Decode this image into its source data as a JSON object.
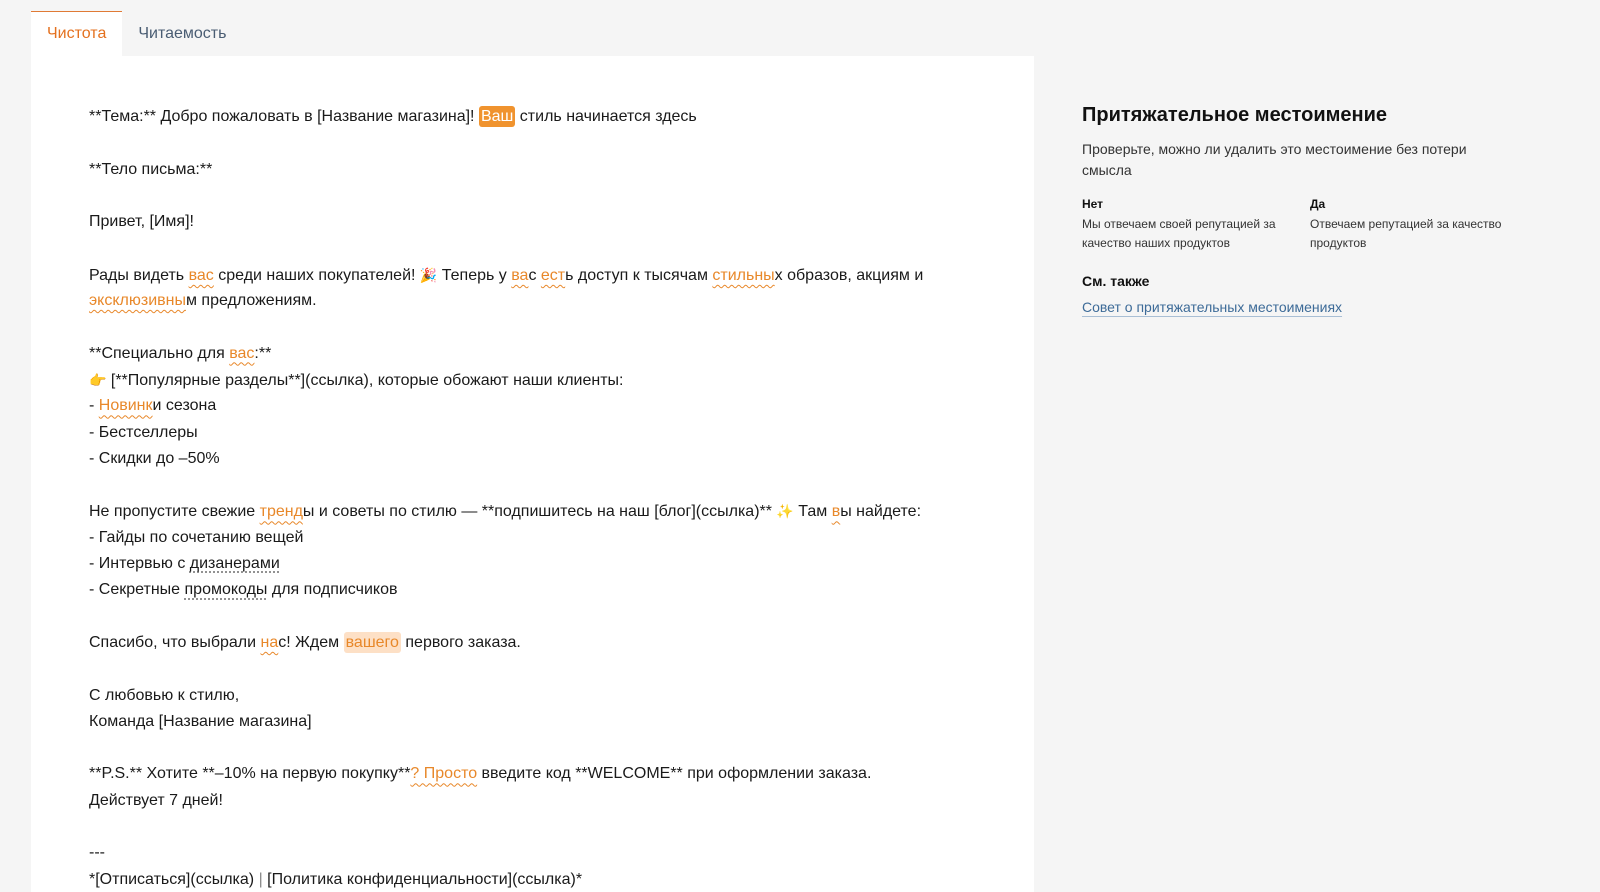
{
  "tabs": [
    {
      "label": "Чистота",
      "active": true
    },
    {
      "label": "Читаемость",
      "active": false
    }
  ],
  "colors": {
    "accent": "#e8882a",
    "selection": "#f0932e",
    "link": "#3d6b98"
  },
  "doc": {
    "l1": {
      "a": "**Тема:** Добро пожаловать в [Название магазина]! ",
      "sel": "Ваш",
      "b": " стиль начинается здесь"
    },
    "l2": "**Тело письма:**",
    "l3": "Привет, [Имя]!",
    "l4": {
      "a": "Рады видеть ",
      "f1": "вас",
      "b": " среди наших покупателей! ",
      "emoji": "🎉",
      "c": " Теперь у ",
      "f2": "ва",
      "d": "с ",
      "f3": "ест",
      "e": "ь доступ к тысячам ",
      "f4": "стильны",
      "f": "х образов, акциям и"
    },
    "l5": {
      "f1": "эксклюзивны",
      "a": "м предложениям."
    },
    "l6": {
      "a": "**Специально для ",
      "f1": "вас",
      "b": ":**"
    },
    "l7": {
      "emoji": "👉",
      "a": " [**Популярные разделы**](ссылка), которые обожают наши клиенты:"
    },
    "l8": {
      "a": "- ",
      "f1": "Новинк",
      "b": "и сезона"
    },
    "l9": "- Бестселлеры",
    "l10": "- Скидки до –50%",
    "l11": {
      "a": "Не пропустите свежие ",
      "f1": "тренд",
      "b": "ы и советы по стилю — **подпишитесь на наш [блог](ссылка)** ",
      "emoji": "✨",
      "c": " Там ",
      "f2": "в",
      "d": "ы найдете:"
    },
    "l12": "- Гайды по сочетанию вещей",
    "l13": {
      "a": "- Интервью с ",
      "d1": "дизанерами"
    },
    "l14": {
      "a": "- Секретные ",
      "d1": "промокоды",
      "b": " для подписчиков"
    },
    "l15": {
      "a": "Спасибо, что выбрали ",
      "f1": "на",
      "b": "с! Ждем ",
      "soft": "вашего",
      "c": " первого заказа."
    },
    "l16": "С любовью к стилю,",
    "l17": "Команда [Название магазина]",
    "l18": {
      "a": "**P.S.** Хотите **–10% на первую покупку**",
      "f1": "? Просто",
      "b": " введите код **WELCOME** при оформлении заказа."
    },
    "l19": "Действует 7 дней!",
    "l20": "---",
    "l21": {
      "a": "*[Отписаться](ссылка) ",
      "sep": "|",
      "b": " [Политика конфиденциальности](ссылка)*"
    }
  },
  "sidebar": {
    "title": "Притяжательное местоимение",
    "description": "Проверьте, можно ли удалить это местоимение без потери смысла",
    "no_label": "Нет",
    "no_example": "Мы отвечаем своей репутацией за качество наших продуктов",
    "yes_label": "Да",
    "yes_example": "Отвечаем репутацией за качество продуктов",
    "see_also": "См. также",
    "link": "Совет о притяжательных местоимениях"
  }
}
